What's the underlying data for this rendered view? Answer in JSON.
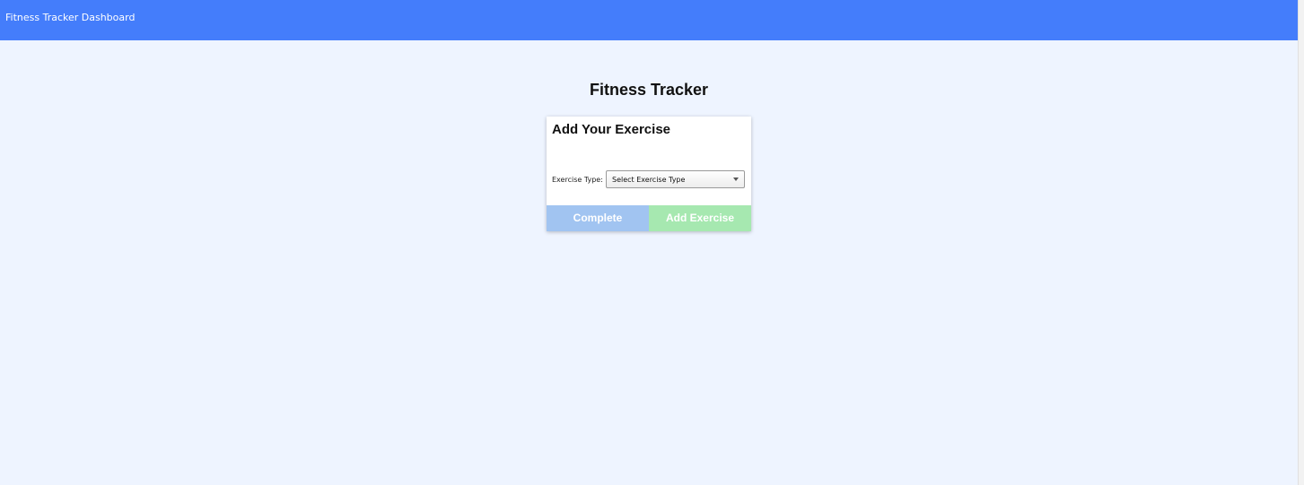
{
  "header": {
    "title": "Fitness Tracker Dashboard"
  },
  "main": {
    "title": "Fitness Tracker",
    "card": {
      "heading": "Add Your Exercise",
      "exercise_type_label": "Exercise Type:",
      "exercise_type_select": {
        "selected": "Select Exercise Type"
      },
      "complete_label": "Complete",
      "add_exercise_label": "Add Exercise"
    }
  },
  "colors": {
    "header_bg": "#447dfb",
    "page_bg": "#eef4ff",
    "complete_button": "#a1c4f1",
    "add_button": "#a6e8b0"
  },
  "icons": {
    "select_caret": "caret-down-icon"
  }
}
